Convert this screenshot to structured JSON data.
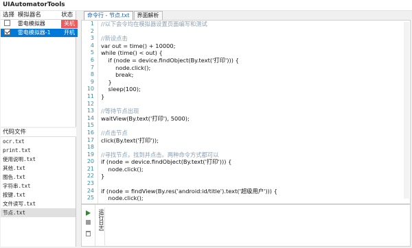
{
  "app": {
    "title": "UIAutomatorTools"
  },
  "emulator_table": {
    "headers": {
      "select": "选择",
      "name": "模拟器名",
      "state": "状态"
    },
    "rows": [
      {
        "checked": false,
        "name": "雷电模拟器",
        "state": "关机",
        "state_color": "#f05a5a"
      },
      {
        "checked": true,
        "name": "雷电模拟器-1",
        "state": "开机",
        "state_color": "#0078d7"
      }
    ]
  },
  "files": {
    "header": "代码文件",
    "items": [
      "ocr.txt",
      "print.txt",
      "使用说明.txt",
      "其他.txt",
      "图色.txt",
      "字符串.txt",
      "按键.txt",
      "文件读写.txt",
      "节点.txt"
    ],
    "active_index": 8
  },
  "tabs": [
    {
      "label": "命令行 - 节点.txt",
      "active": true
    },
    {
      "label": "界面解析",
      "active": false
    }
  ],
  "editor": {
    "line_numbers": [
      "1",
      "2",
      "3",
      "4",
      "5",
      "6",
      "7",
      "8",
      "9",
      "10",
      "11",
      "12",
      "13",
      "14",
      "15",
      "16",
      "17",
      "18",
      "19",
      "20",
      "21",
      "22",
      "23",
      "24",
      "25"
    ],
    "lines": [
      "//以下会令均在模拟器设置页面编写和测试",
      "",
      "//新设点击",
      "var out = time() + 10000;",
      "while (time() < out) {",
      "    if (node = device.findObject(By.text('打印'))) {",
      "        node.click();",
      "        break;",
      "    }",
      "    sleep(100);",
      "}",
      "",
      "//等待节点出现",
      "waitView(By.text('打印'), 5000);",
      "",
      "//点击节点",
      "click(By.text('打印'));",
      "",
      "//寻找节点，找到并点击。两种命令方式都可以",
      "if (node = device.findObject(By.text('打印'))) {",
      "    node.click();",
      "}",
      "",
      "if (node = findView(By.res('android:id/title').text('超级用户'))) {",
      "    node.click();"
    ]
  },
  "console": {
    "label": "运行日志"
  },
  "colors": {
    "selected_row": "#0078d7",
    "comment": "#8aa0b5",
    "line_number": "#2b91af",
    "string": "#a31515"
  },
  "icons": [
    "run-icon",
    "stop-icon",
    "clear-icon"
  ]
}
